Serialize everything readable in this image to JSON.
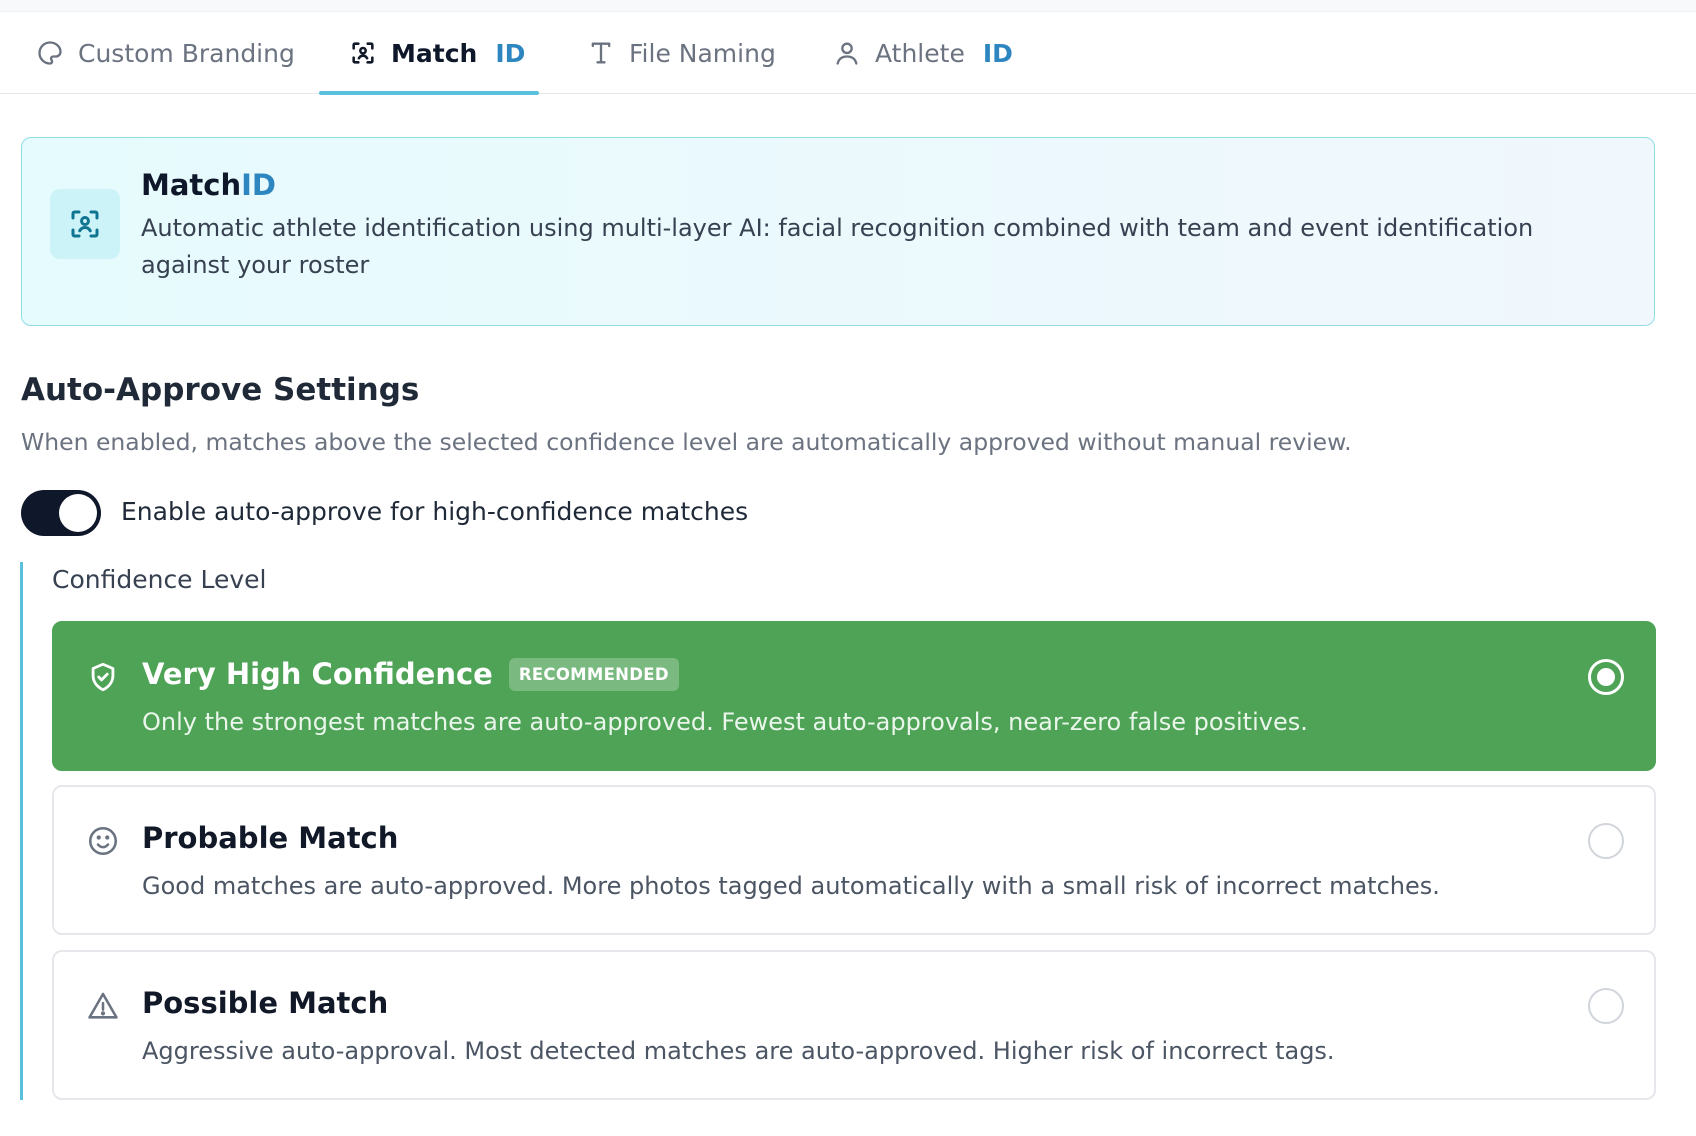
{
  "tabs": [
    {
      "label": "Custom Branding",
      "accent": "",
      "icon": "palette-icon",
      "active": false
    },
    {
      "label": "Match",
      "accent": "ID",
      "icon": "face-scan-icon",
      "active": true
    },
    {
      "label": "File Naming",
      "accent": "",
      "icon": "text-icon",
      "active": false
    },
    {
      "label": "Athlete",
      "accent": "ID",
      "icon": "user-icon",
      "active": false
    }
  ],
  "banner": {
    "title": "Match",
    "title_accent": "ID",
    "description": "Automatic athlete identification using multi-layer AI: facial recognition combined with team and event identification against your roster",
    "icon": "face-scan-icon"
  },
  "auto_approve": {
    "title": "Auto-Approve Settings",
    "description": "When enabled, matches above the selected confidence level are automatically approved without manual review.",
    "toggle_label": "Enable auto-approve for high-confidence matches",
    "toggle_on": true,
    "confidence_label": "Confidence Level",
    "options": [
      {
        "title": "Very High Confidence",
        "badge": "RECOMMENDED",
        "description": "Only the strongest matches are auto-approved. Fewest auto-approvals, near-zero false positives.",
        "icon": "shield-check-icon",
        "selected": true
      },
      {
        "title": "Probable Match",
        "badge": "",
        "description": "Good matches are auto-approved. More photos tagged automatically with a small risk of incorrect matches.",
        "icon": "smile-icon",
        "selected": false
      },
      {
        "title": "Possible Match",
        "badge": "",
        "description": "Aggressive auto-approval. Most detected matches are auto-approved. Higher risk of incorrect tags.",
        "icon": "warning-icon",
        "selected": false
      }
    ]
  },
  "colors": {
    "accent_blue": "#2e86c1",
    "tab_underline": "#5bc0de",
    "selected_green": "#4ea356",
    "toggle_dark": "#0f172a"
  }
}
